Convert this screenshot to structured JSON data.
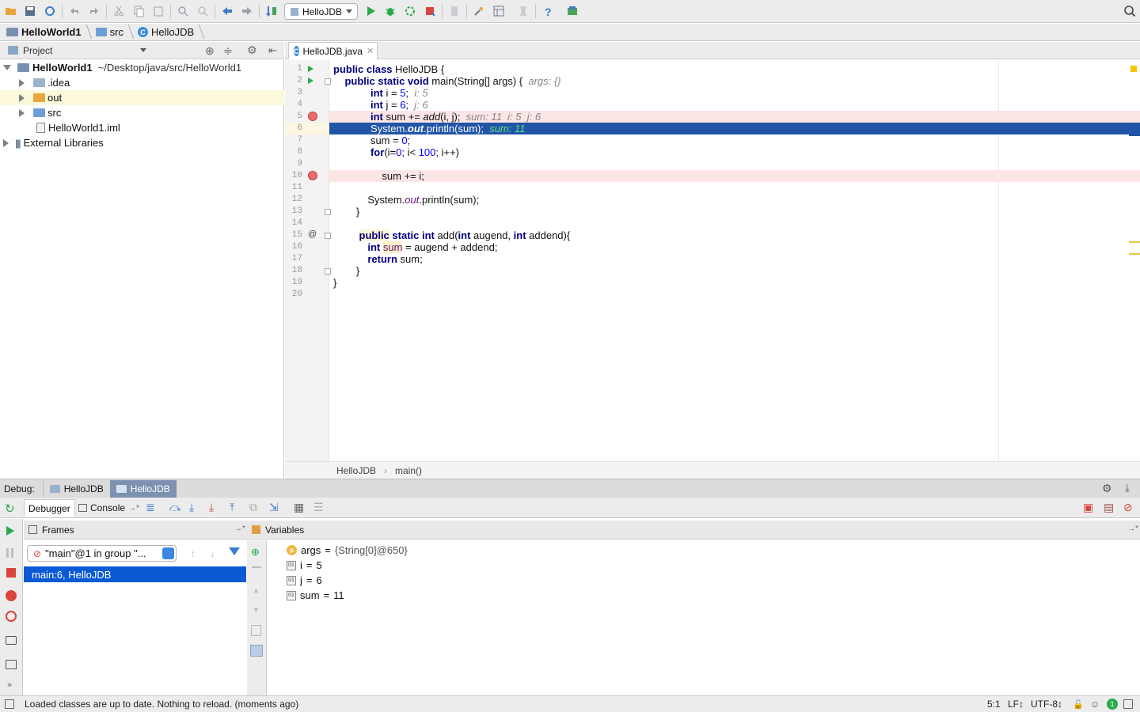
{
  "toolbar": {
    "run_config": "HelloJDB"
  },
  "breadcrumb": {
    "items": [
      "HelloWorld1",
      "src",
      "HelloJDB"
    ]
  },
  "project": {
    "header": "Project",
    "root_name": "HelloWorld1",
    "root_path": "~/Desktop/java/src/HelloWorld1",
    "items": [
      ".idea",
      "out",
      "src",
      "HelloWorld1.iml",
      "External Libraries"
    ]
  },
  "editor": {
    "tab": "HelloJDB.java",
    "line_numbers": [
      "1",
      "2",
      "3",
      "4",
      "5",
      "6",
      "7",
      "8",
      "9",
      "10",
      "11",
      "12",
      "13",
      "14",
      "15",
      "16",
      "17",
      "18",
      "19",
      "20"
    ],
    "breadcrumb": [
      "HelloJDB",
      "main()"
    ]
  },
  "debug": {
    "label": "Debug:",
    "sessions": [
      "HelloJDB",
      "HelloJDB"
    ],
    "tabs": [
      "Debugger",
      "Console"
    ],
    "frames_title": "Frames",
    "variables_title": "Variables",
    "thread": "\"main\"@1 in group \"...",
    "frame": "main:6, HelloJDB",
    "variables": [
      {
        "name": "args",
        "value": "{String[0]@650}",
        "icon": "p"
      },
      {
        "name": "i",
        "value": "5",
        "icon": "01"
      },
      {
        "name": "j",
        "value": "6",
        "icon": "01"
      },
      {
        "name": "sum",
        "value": "11",
        "icon": "01"
      }
    ]
  },
  "status": {
    "message": "Loaded classes are up to date. Nothing to reload. (moments ago)",
    "position": "5:1",
    "line_sep": "LF↕",
    "encoding": "UTF-8↕",
    "notifications": "1"
  },
  "colors": {
    "accent": "#0a5ad6",
    "breakpoint_line": "#fbe5e5",
    "run_green": "#2ba84a",
    "breakpoint": "#e86a6a"
  }
}
